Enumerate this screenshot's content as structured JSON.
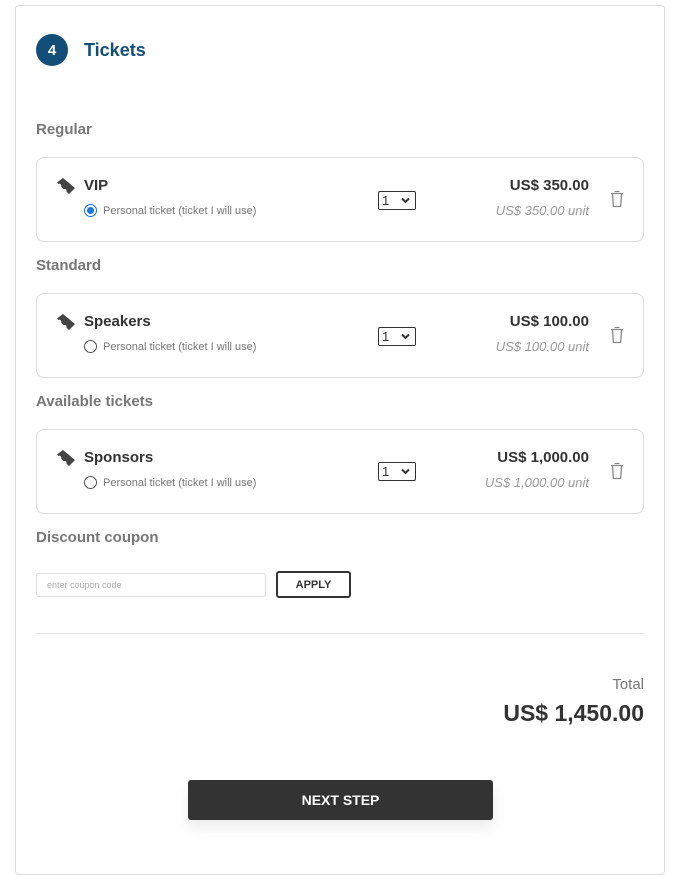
{
  "step": {
    "number": "4",
    "title": "Tickets"
  },
  "groups": [
    {
      "label": "Regular",
      "ticket": {
        "name": "VIP",
        "personal_label": "Personal ticket (ticket I will use)",
        "personal_selected": true,
        "quantity": "1",
        "price": "US$ 350.00",
        "unit_price": "US$ 350.00 unit"
      }
    },
    {
      "label": "Standard",
      "ticket": {
        "name": "Speakers",
        "personal_label": "Personal ticket (ticket I will use)",
        "personal_selected": false,
        "quantity": "1",
        "price": "US$ 100.00",
        "unit_price": "US$ 100.00 unit"
      }
    },
    {
      "label": "Available tickets",
      "ticket": {
        "name": "Sponsors",
        "personal_label": "Personal ticket (ticket I will use)",
        "personal_selected": false,
        "quantity": "1",
        "price": "US$ 1,000.00",
        "unit_price": "US$ 1,000.00 unit"
      }
    }
  ],
  "coupon": {
    "label": "Discount coupon",
    "placeholder": "enter coupon code",
    "apply_label": "APPLY"
  },
  "total": {
    "label": "Total",
    "value": "US$ 1,450.00"
  },
  "next_button": {
    "label": "NEXT STEP"
  },
  "icons": {
    "step": "step-number-badge",
    "ticket": "ticket-icon",
    "select": "chevron-down-icon",
    "delete": "trash-icon"
  },
  "colors": {
    "accent": "#124e78",
    "radio_selected": "#1a73e8",
    "primary_button": "#333333",
    "muted_text": "#777777"
  }
}
